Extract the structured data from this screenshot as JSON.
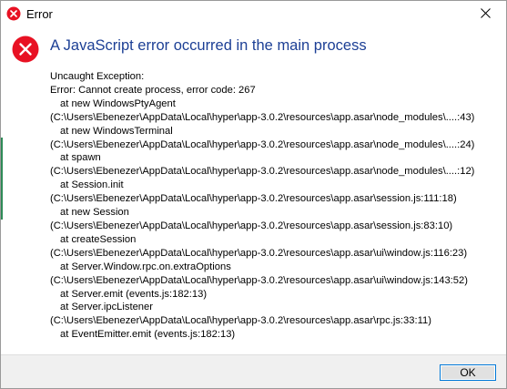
{
  "window": {
    "title": "Error",
    "close_glyph": "✕"
  },
  "dialog": {
    "main_instruction": "A JavaScript error occurred in the main process",
    "icon": "error-icon",
    "accent_color": "#1c3f95",
    "error_color": "#e81123",
    "lines": [
      {
        "text": "Uncaught Exception:",
        "indent": false
      },
      {
        "text": "Error: Cannot create process, error code: 267",
        "indent": false
      },
      {
        "text": "at new WindowsPtyAgent",
        "indent": true
      },
      {
        "text": "(C:\\Users\\Ebenezer\\AppData\\Local\\hyper\\app-3.0.2\\resources\\app.asar\\node_modules\\....:43)",
        "indent": false
      },
      {
        "text": "at new WindowsTerminal",
        "indent": true
      },
      {
        "text": "(C:\\Users\\Ebenezer\\AppData\\Local\\hyper\\app-3.0.2\\resources\\app.asar\\node_modules\\....:24)",
        "indent": false
      },
      {
        "text": "at spawn",
        "indent": true
      },
      {
        "text": "(C:\\Users\\Ebenezer\\AppData\\Local\\hyper\\app-3.0.2\\resources\\app.asar\\node_modules\\....:12)",
        "indent": false
      },
      {
        "text": "at Session.init",
        "indent": true
      },
      {
        "text": "(C:\\Users\\Ebenezer\\AppData\\Local\\hyper\\app-3.0.2\\resources\\app.asar\\session.js:111:18)",
        "indent": false
      },
      {
        "text": "at new Session",
        "indent": true
      },
      {
        "text": "(C:\\Users\\Ebenezer\\AppData\\Local\\hyper\\app-3.0.2\\resources\\app.asar\\session.js:83:10)",
        "indent": false
      },
      {
        "text": "at createSession",
        "indent": true
      },
      {
        "text": "(C:\\Users\\Ebenezer\\AppData\\Local\\hyper\\app-3.0.2\\resources\\app.asar\\ui\\window.js:116:23)",
        "indent": false
      },
      {
        "text": "at Server.Window.rpc.on.extraOptions",
        "indent": true
      },
      {
        "text": "(C:\\Users\\Ebenezer\\AppData\\Local\\hyper\\app-3.0.2\\resources\\app.asar\\ui\\window.js:143:52)",
        "indent": false
      },
      {
        "text": "at Server.emit (events.js:182:13)",
        "indent": true
      },
      {
        "text": "at Server.ipcListener",
        "indent": true
      },
      {
        "text": "(C:\\Users\\Ebenezer\\AppData\\Local\\hyper\\app-3.0.2\\resources\\app.asar\\rpc.js:33:11)",
        "indent": false
      },
      {
        "text": "at EventEmitter.emit (events.js:182:13)",
        "indent": true
      }
    ]
  },
  "footer": {
    "ok_label": "OK"
  }
}
